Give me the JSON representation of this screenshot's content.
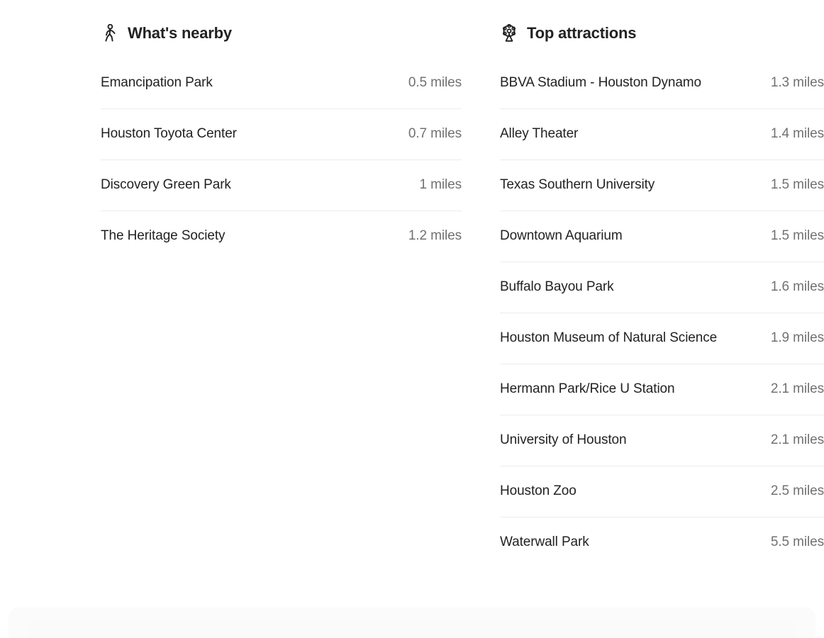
{
  "sections": [
    {
      "id": "whats-nearby",
      "title": "What's nearby",
      "icon": "walking-person-icon",
      "items": [
        {
          "name": "Emancipation Park",
          "distance": "0.5 miles"
        },
        {
          "name": "Houston Toyota Center",
          "distance": "0.7 miles"
        },
        {
          "name": "Discovery Green Park",
          "distance": "1 miles"
        },
        {
          "name": "The Heritage Society",
          "distance": "1.2 miles"
        }
      ]
    },
    {
      "id": "top-attractions",
      "title": "Top attractions",
      "icon": "ferris-wheel-icon",
      "items": [
        {
          "name": "BBVA Stadium - Houston Dynamo",
          "distance": "1.3 miles"
        },
        {
          "name": "Alley Theater",
          "distance": "1.4 miles"
        },
        {
          "name": "Texas Southern University",
          "distance": "1.5 miles"
        },
        {
          "name": "Downtown Aquarium",
          "distance": "1.5 miles"
        },
        {
          "name": "Buffalo Bayou Park",
          "distance": "1.6 miles"
        },
        {
          "name": "Houston Museum of Natural Science",
          "distance": "1.9 miles"
        },
        {
          "name": "Hermann Park/Rice U Station",
          "distance": "2.1 miles"
        },
        {
          "name": "University of Houston",
          "distance": "2.1 miles"
        },
        {
          "name": "Houston Zoo",
          "distance": "2.5 miles"
        },
        {
          "name": "Waterwall Park",
          "distance": "5.5 miles"
        }
      ]
    }
  ],
  "colors": {
    "background": "#ffffff",
    "title_text": "#222222",
    "item_text": "#222222",
    "distance_text": "#717171",
    "divider": "#ececec"
  }
}
